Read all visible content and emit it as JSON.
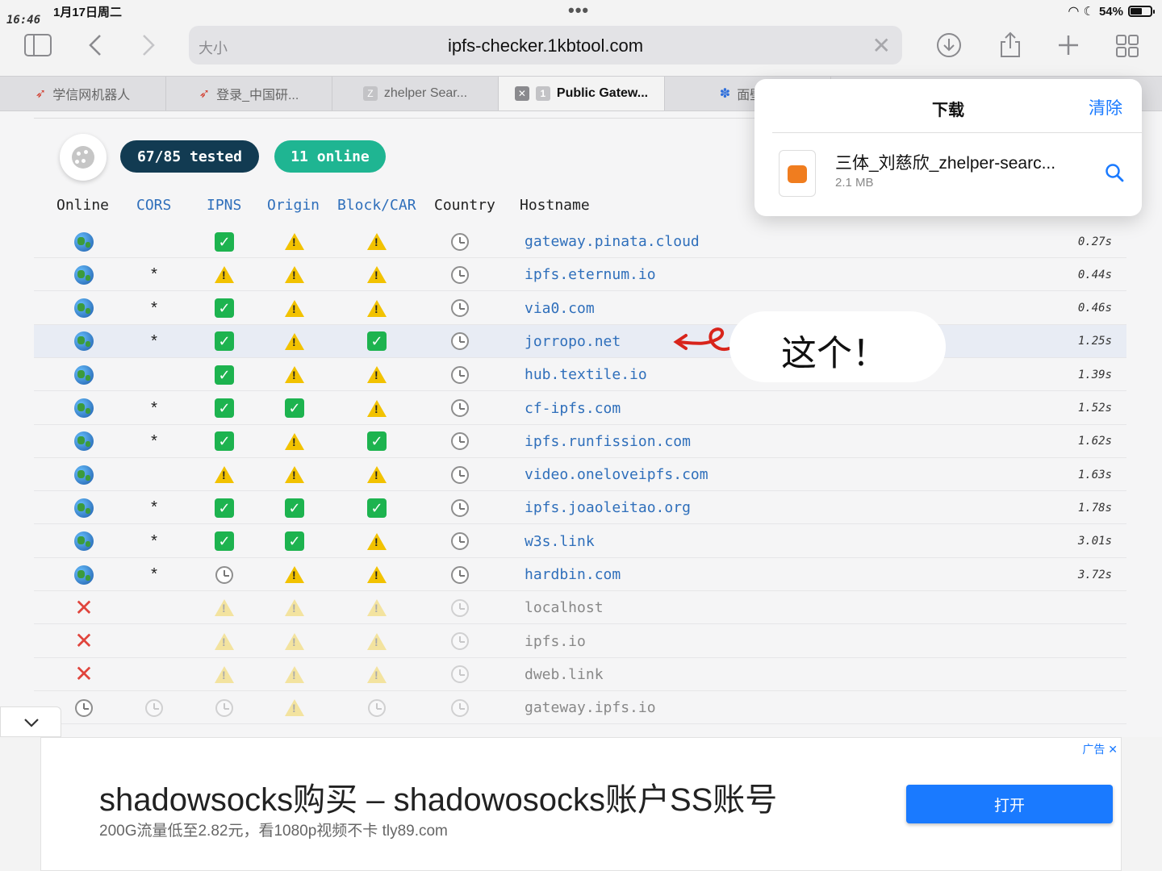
{
  "status": {
    "time": "16:46",
    "date": "1月17日周二",
    "battery": "54%",
    "battery_level": 0.54
  },
  "toolbar": {
    "size_label": "大小",
    "url": "ipfs-checker.1kbtool.com"
  },
  "tabs": [
    {
      "label": "学信网机器人"
    },
    {
      "label": "登录_中国研..."
    },
    {
      "label": "zhelper Sear..."
    },
    {
      "label": "Public Gatew..."
    },
    {
      "label": "面壁者"
    }
  ],
  "summary": {
    "tested": "67/85 tested",
    "online": "11 online"
  },
  "columns": [
    "Online",
    "CORS",
    "IPNS",
    "Origin",
    "Block/CAR",
    "Country",
    "Hostname"
  ],
  "rows": [
    {
      "online": "globe",
      "cors": "",
      "ipns": "ok",
      "origin": "warn",
      "block": "warn",
      "country": "clock",
      "host": "gateway.pinata.cloud",
      "time": "0.27s"
    },
    {
      "online": "globe",
      "cors": "*",
      "ipns": "warn",
      "origin": "warn",
      "block": "warn",
      "country": "clock",
      "host": "ipfs.eternum.io",
      "time": "0.44s"
    },
    {
      "online": "globe",
      "cors": "*",
      "ipns": "ok",
      "origin": "warn",
      "block": "warn",
      "country": "clock",
      "host": "via0.com",
      "time": "0.46s"
    },
    {
      "online": "globe",
      "cors": "*",
      "ipns": "ok",
      "origin": "warn",
      "block": "ok",
      "country": "clock",
      "host": "jorropo.net",
      "time": "1.25s",
      "highlight": true
    },
    {
      "online": "globe",
      "cors": "",
      "ipns": "ok",
      "origin": "warn",
      "block": "warn",
      "country": "clock",
      "host": "hub.textile.io",
      "time": "1.39s"
    },
    {
      "online": "globe",
      "cors": "*",
      "ipns": "ok",
      "origin": "ok",
      "block": "warn",
      "country": "clock",
      "host": "cf-ipfs.com",
      "time": "1.52s"
    },
    {
      "online": "globe",
      "cors": "*",
      "ipns": "ok",
      "origin": "warn",
      "block": "ok",
      "country": "clock",
      "host": "ipfs.runfission.com",
      "time": "1.62s"
    },
    {
      "online": "globe",
      "cors": "",
      "ipns": "warn",
      "origin": "warn",
      "block": "warn",
      "country": "clock",
      "host": "video.oneloveipfs.com",
      "time": "1.63s"
    },
    {
      "online": "globe",
      "cors": "*",
      "ipns": "ok",
      "origin": "ok",
      "block": "ok",
      "country": "clock",
      "host": "ipfs.joaoleitao.org",
      "time": "1.78s"
    },
    {
      "online": "globe",
      "cors": "*",
      "ipns": "ok",
      "origin": "ok",
      "block": "warn",
      "country": "clock",
      "host": "w3s.link",
      "time": "3.01s"
    },
    {
      "online": "globe",
      "cors": "*",
      "ipns": "clock",
      "origin": "warn",
      "block": "warn",
      "country": "clock",
      "host": "hardbin.com",
      "time": "3.72s"
    },
    {
      "online": "cross",
      "cors": "",
      "ipns": "warn",
      "origin": "warn",
      "block": "warn",
      "country": "clock",
      "host": "localhost",
      "time": "",
      "off": true
    },
    {
      "online": "cross",
      "cors": "",
      "ipns": "warn",
      "origin": "warn",
      "block": "warn",
      "country": "clock",
      "host": "ipfs.io",
      "time": "",
      "off": true
    },
    {
      "online": "cross",
      "cors": "",
      "ipns": "warn",
      "origin": "warn",
      "block": "warn",
      "country": "clock",
      "host": "dweb.link",
      "time": "",
      "off": true
    },
    {
      "online": "clock",
      "cors": "clock",
      "ipns": "clock",
      "origin": "warn",
      "block": "clock",
      "country": "clock",
      "host": "gateway.ipfs.io",
      "time": "",
      "off": true
    }
  ],
  "downloads": {
    "title": "下载",
    "clear_label": "清除",
    "file_name": "三体_刘慈欣_zhelper-searc...",
    "file_size": "2.1 MB"
  },
  "annotation": {
    "text": "这个！"
  },
  "ad": {
    "label": "广告",
    "headline": "shadowsocks购买 – shadowosocks账户SS账号",
    "sub": "200G流量低至2.82元，看1080p视频不卡 tly89.com",
    "button": "打开"
  },
  "colors": {
    "accent": "#1a7aff",
    "pill_dark": "#123b52",
    "pill_green": "#1fb592",
    "link": "#2f6fbb"
  }
}
